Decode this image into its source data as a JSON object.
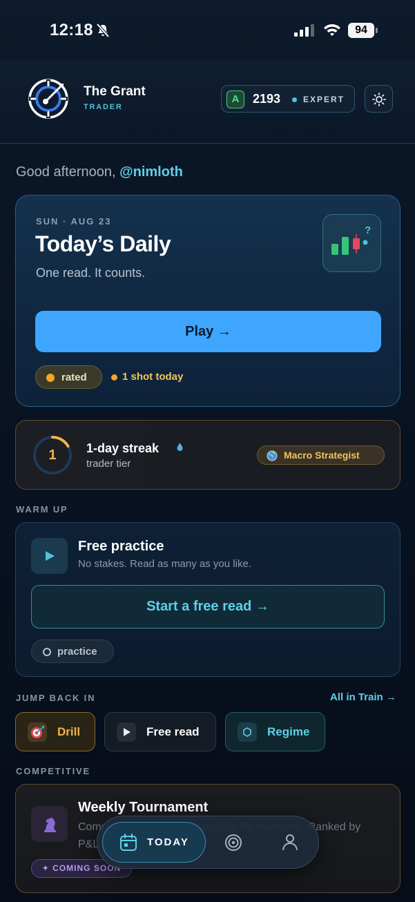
{
  "status_bar": {
    "time": "12:18",
    "battery": "94"
  },
  "header": {
    "brand_name": "The Grant",
    "brand_sub": "TRADER",
    "grade": "A",
    "rating": "2193",
    "tier": "EXPERT"
  },
  "greeting": {
    "prefix": "Good afternoon, ",
    "handle": "@nimloth"
  },
  "daily": {
    "date": "SUN · AUG 23",
    "title": "Today’s Daily",
    "subtitle": "One read. It counts.",
    "play_label": "Play →",
    "rated_label": "rated",
    "shots_label": "1 shot today"
  },
  "streak": {
    "count": "1",
    "title": "1-day streak",
    "subtitle": "trader tier",
    "badge": "Macro Strategist"
  },
  "warmup": {
    "section": "WARM UP",
    "title": "Free practice",
    "subtitle": "No stakes. Read as many as you like.",
    "button": "Start a free read →",
    "pill": "practice"
  },
  "jump_back": {
    "section": "JUMP BACK IN",
    "link": "All in Train →",
    "chips": [
      {
        "label": "Drill"
      },
      {
        "label": "Free read"
      },
      {
        "label": "Regime"
      }
    ]
  },
  "competitive": {
    "section": "COMPETITIVE",
    "title": "Weekly Tournament",
    "description": "Compete on the same scenarios for everyone. Ranked by P&L.",
    "badge": "✦ COMING SOON"
  },
  "nav": {
    "today": "TODAY"
  },
  "colors": {
    "accent": "#3ea6ff",
    "teal": "#5fd0e6",
    "gold": "#f2b447",
    "green": "#3bd47a"
  }
}
